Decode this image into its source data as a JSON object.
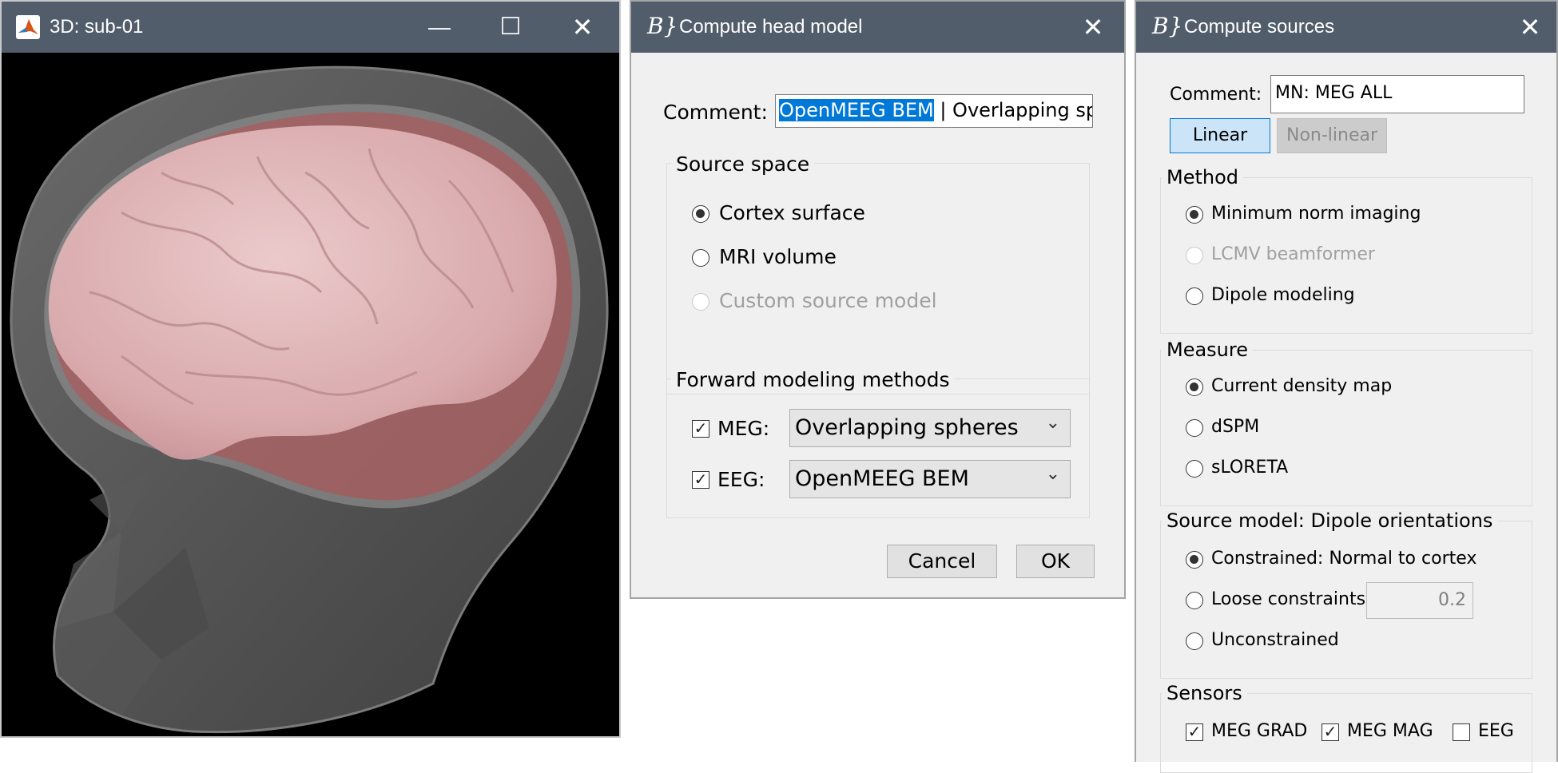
{
  "viewer": {
    "title": "3D: sub-01",
    "minimize_glyph": "—",
    "maximize_glyph": "☐",
    "close_glyph": "✕",
    "icon": "matlab-icon"
  },
  "headmodel": {
    "title": "Compute head model",
    "close_glyph": "✕",
    "comment_label": "Comment:",
    "comment_selected": "OpenMEEG BEM",
    "comment_rest": " | Overlapping sp",
    "source_space": {
      "legend": "Source space",
      "options": [
        "Cortex surface",
        "MRI volume",
        "Custom source model"
      ],
      "selected": "Cortex surface"
    },
    "forward": {
      "legend": "Forward modeling methods",
      "meg_label": "MEG:",
      "meg_value": "Overlapping spheres",
      "eeg_label": "EEG:",
      "eeg_value": "OpenMEEG BEM",
      "check_glyph": "✓"
    },
    "cancel_label": "Cancel",
    "ok_label": "OK"
  },
  "sources": {
    "title": "Compute sources",
    "close_glyph": "✕",
    "comment_label": "Comment:",
    "comment_value": "MN: MEG ALL",
    "linear_label": "Linear",
    "nonlinear_label": "Non-linear",
    "method": {
      "legend": "Method",
      "options": [
        "Minimum norm imaging",
        "LCMV beamformer",
        "Dipole modeling"
      ]
    },
    "measure": {
      "legend": "Measure",
      "options": [
        "Current density map",
        "dSPM",
        "sLORETA"
      ]
    },
    "source_model": {
      "legend": "Source model: Dipole orientations",
      "constrained": "Constrained:  Normal to cortex",
      "loose": "Loose constraints",
      "loose_value": "0.2",
      "unconstrained": "Unconstrained"
    },
    "sensors": {
      "legend": "Sensors",
      "meg_grad": "MEG GRAD",
      "meg_mag": "MEG MAG",
      "eeg": "EEG",
      "check_glyph": "✓"
    }
  },
  "colors": {
    "titlebar": "#525d6c",
    "selection": "#0078d7",
    "toggle_active": "#cce4f7"
  }
}
